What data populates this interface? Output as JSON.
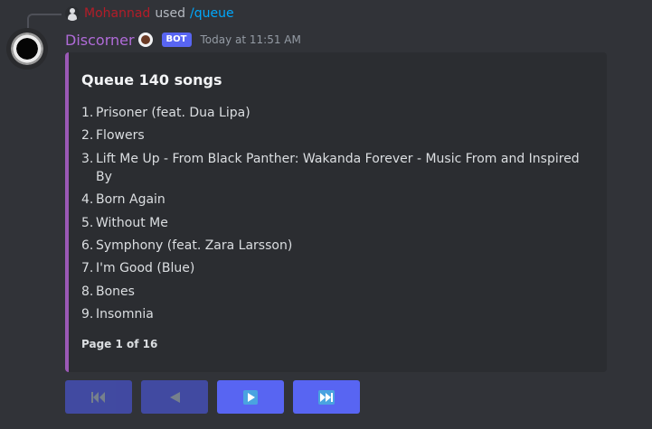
{
  "reply": {
    "username": "Mohannad",
    "used": "used",
    "command": "/queue"
  },
  "message": {
    "author": "Discorner",
    "bot_tag": "BOT",
    "timestamp": "Today at 11:51 AM"
  },
  "embed": {
    "accent_color": "#9b59b6",
    "title": "Queue 140 songs",
    "songs": [
      {
        "num": "1.",
        "name": "Prisoner (feat. Dua Lipa)"
      },
      {
        "num": "2.",
        "name": "Flowers"
      },
      {
        "num": "3.",
        "name": "Lift Me Up - From Black Panther: Wakanda Forever - Music From and Inspired By"
      },
      {
        "num": "4.",
        "name": "Born Again"
      },
      {
        "num": "5.",
        "name": "Without Me"
      },
      {
        "num": "6.",
        "name": "Symphony (feat. Zara Larsson)"
      },
      {
        "num": "7.",
        "name": "I'm Good (Blue)"
      },
      {
        "num": "8.",
        "name": "Bones"
      },
      {
        "num": "9.",
        "name": "Insomnia"
      }
    ],
    "footer": "Page 1 of 16"
  },
  "buttons": [
    {
      "icon": "skip-to-start-icon",
      "enabled": false
    },
    {
      "icon": "previous-icon",
      "enabled": false
    },
    {
      "icon": "next-icon",
      "enabled": true
    },
    {
      "icon": "skip-to-end-icon",
      "enabled": true
    }
  ],
  "colors": {
    "background": "#313338",
    "embed_background": "#2b2d31",
    "button_primary": "#5865f2",
    "username": "#b06bd8",
    "reply_username": "#b31d28",
    "command_link": "#00a8fc"
  }
}
